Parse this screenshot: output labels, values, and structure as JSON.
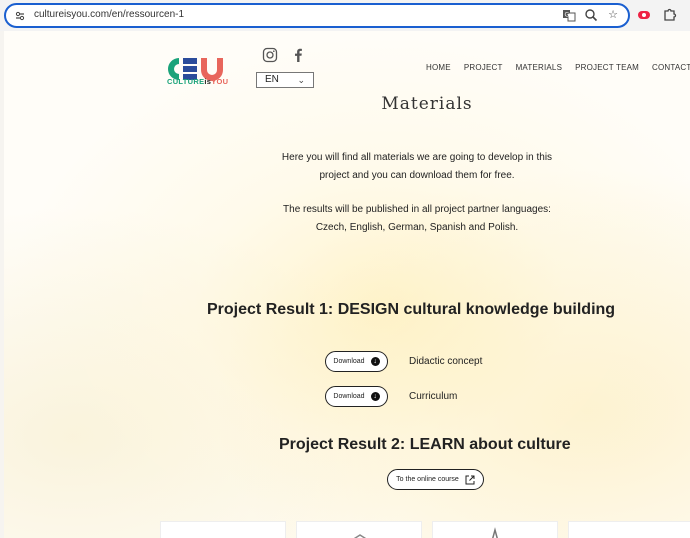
{
  "browser": {
    "url": "cultureisyou.com/en/ressourcen-1",
    "icons": [
      "tune-icon",
      "translate-icon",
      "zoom-icon",
      "star-icon",
      "record-extension-icon",
      "puzzle-icon"
    ]
  },
  "header": {
    "logo_text": {
      "culture": "CULTURE",
      "is": "is",
      "you": "YOU"
    },
    "language": "EN",
    "nav": [
      "HOME",
      "PROJECT",
      "MATERIALS",
      "PROJECT TEAM",
      "CONTACT"
    ]
  },
  "main": {
    "title": "Materials",
    "intro_1": [
      "Here you will find all materials we are going to develop in this",
      "project and you can download them for free."
    ],
    "intro_2": [
      "The results will be published in all project partner languages:",
      "Czech, English, German, Spanish and Polish."
    ],
    "result_1": {
      "heading": "Project Result 1: DESIGN cultural knowledge building",
      "downloads": [
        {
          "button": "Download",
          "label": "Didactic concept"
        },
        {
          "button": "Download",
          "label": "Curriculum"
        }
      ]
    },
    "result_2": {
      "heading": "Project Result 2: LEARN about culture",
      "button": "To the online course"
    }
  },
  "colors": {
    "focus_ring": "#1a5fd0",
    "logo_green": "#1aa37a",
    "logo_blue": "#2b4c9b",
    "logo_coral": "#e8665c"
  }
}
